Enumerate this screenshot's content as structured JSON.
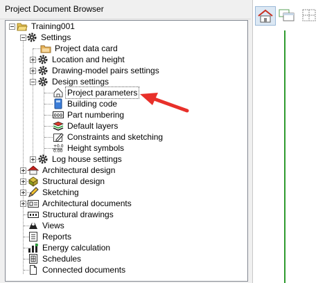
{
  "panel": {
    "title": "Project Document Browser"
  },
  "tree": {
    "root": "Training001",
    "settings": "Settings",
    "project_data_card": "Project data card",
    "location_and_height": "Location and height",
    "drawing_model_pairs": "Drawing-model pairs settings",
    "design_settings": "Design settings",
    "project_parameters": "Project parameters",
    "building_code": "Building code",
    "part_numbering": "Part numbering",
    "default_layers": "Default layers",
    "constraints_and_sketching": "Constraints and sketching",
    "height_symbols": "Height symbols",
    "log_house_settings": "Log house settings",
    "architectural_design": "Architectural design",
    "structural_design": "Structural design",
    "sketching": "Sketching",
    "architectural_documents": "Architectural documents",
    "structural_drawings": "Structural drawings",
    "views": "Views",
    "reports": "Reports",
    "energy_calculation": "Energy calculation",
    "schedules": "Schedules",
    "connected_documents": "Connected documents"
  },
  "colors": {
    "annotation_arrow": "#e8302a",
    "view_guide_line": "#2e9a2e",
    "tree_border": "#828790"
  }
}
